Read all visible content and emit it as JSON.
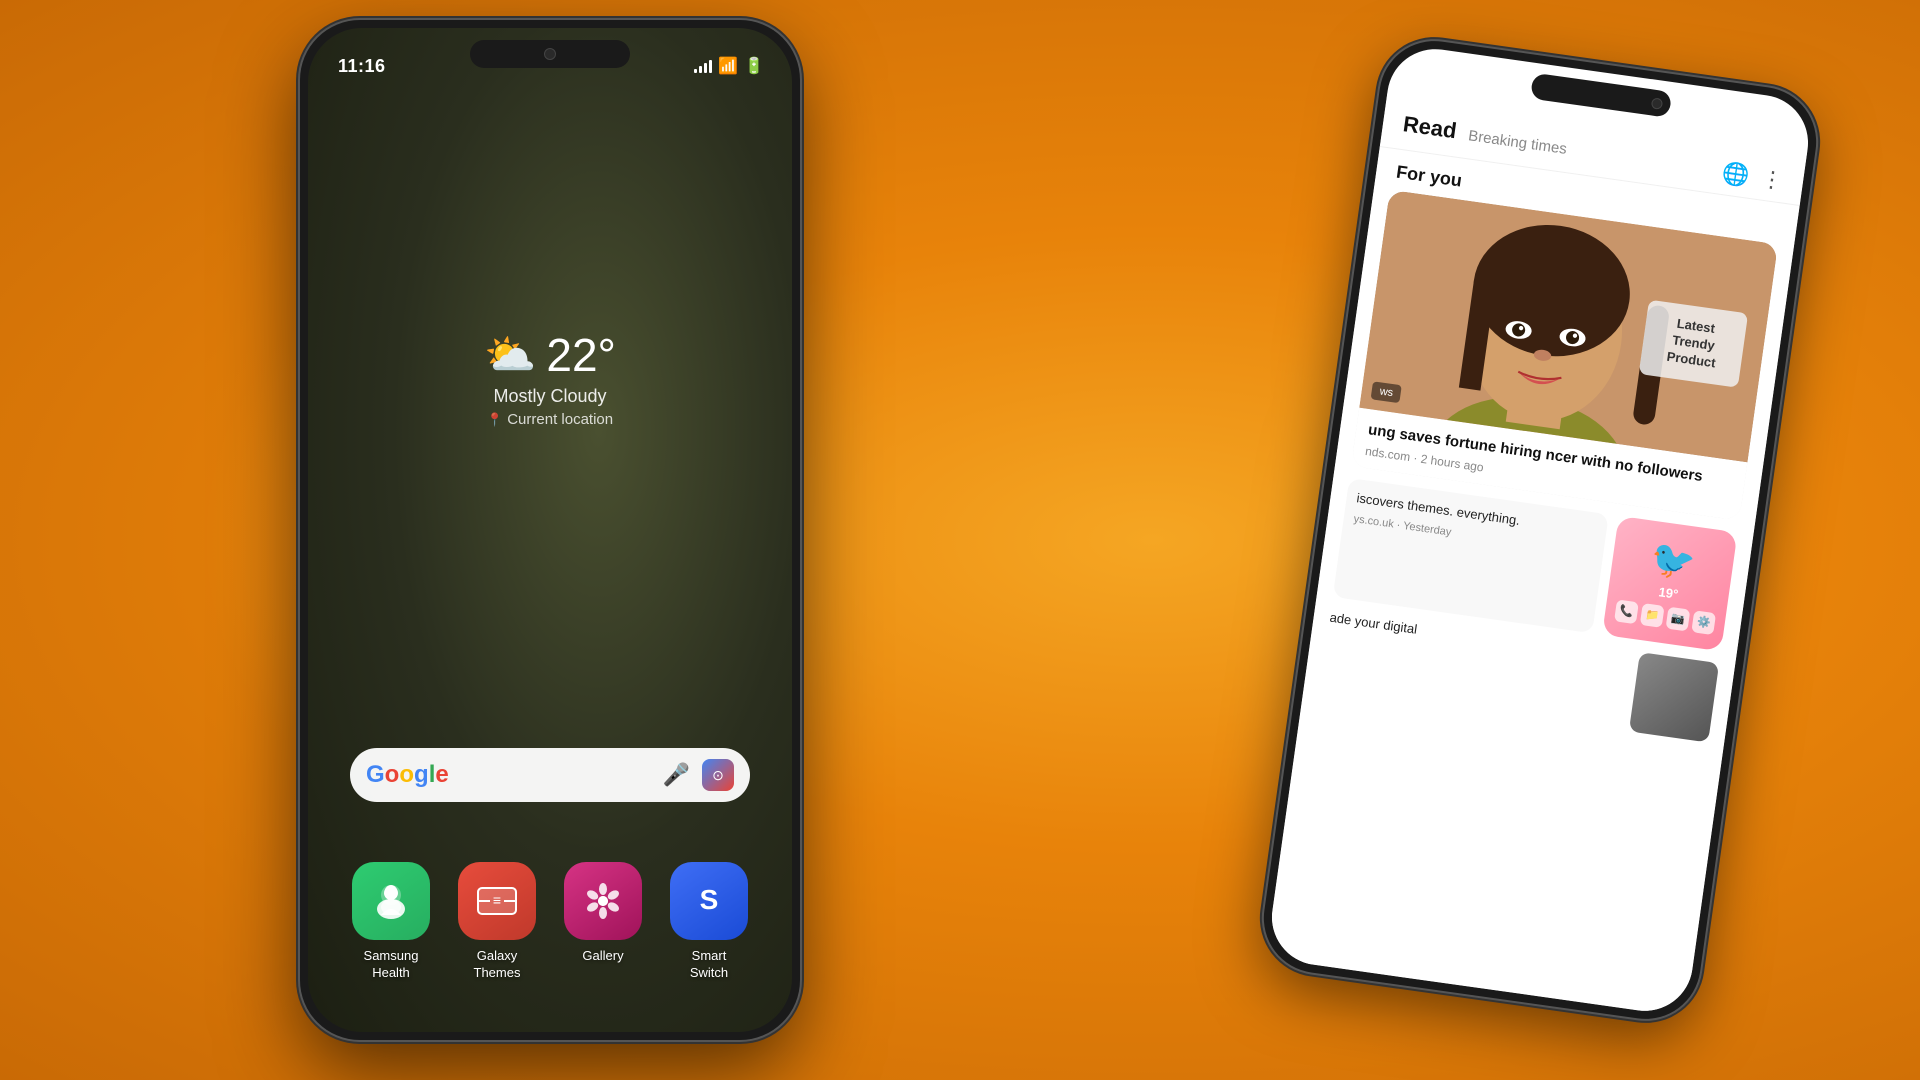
{
  "background": {
    "gradient": "radial-gradient orange"
  },
  "phone_left": {
    "status": {
      "time": "11:16",
      "signal": true,
      "wifi": true,
      "battery": true
    },
    "weather": {
      "temperature": "22°",
      "description": "Mostly Cloudy",
      "location": "Current location"
    },
    "search_bar": {
      "google_letter": "G",
      "mic_label": "🎤",
      "lens_label": "📷"
    },
    "apps": [
      {
        "name": "Samsung Health",
        "icon": "🧘",
        "color_class": "icon-samsung-health"
      },
      {
        "name": "Galaxy Themes",
        "icon": "⊛",
        "color_class": "icon-galaxy-themes"
      },
      {
        "name": "Gallery",
        "icon": "✿",
        "color_class": "icon-gallery"
      },
      {
        "name": "Smart Switch",
        "icon": "S",
        "color_class": "icon-smart-switch"
      }
    ]
  },
  "phone_right": {
    "app_name": "Read",
    "app_subtitle": "Breaking times",
    "section_title": "For you",
    "news_items": [
      {
        "headline": "ung saves fortune hiring ncer with no followers",
        "source": "nds.com",
        "time_ago": "2 hours ago",
        "has_image": true,
        "product_text": "Latest Trendy Product",
        "tag": "ws"
      },
      {
        "headline": "iscovers themes. everything.",
        "source": "ys.co.uk",
        "time_ago": "Yesterday",
        "has_pink_card": true
      },
      {
        "headline": "ade your digital",
        "source": "",
        "time_ago": "",
        "has_image": true
      }
    ]
  }
}
